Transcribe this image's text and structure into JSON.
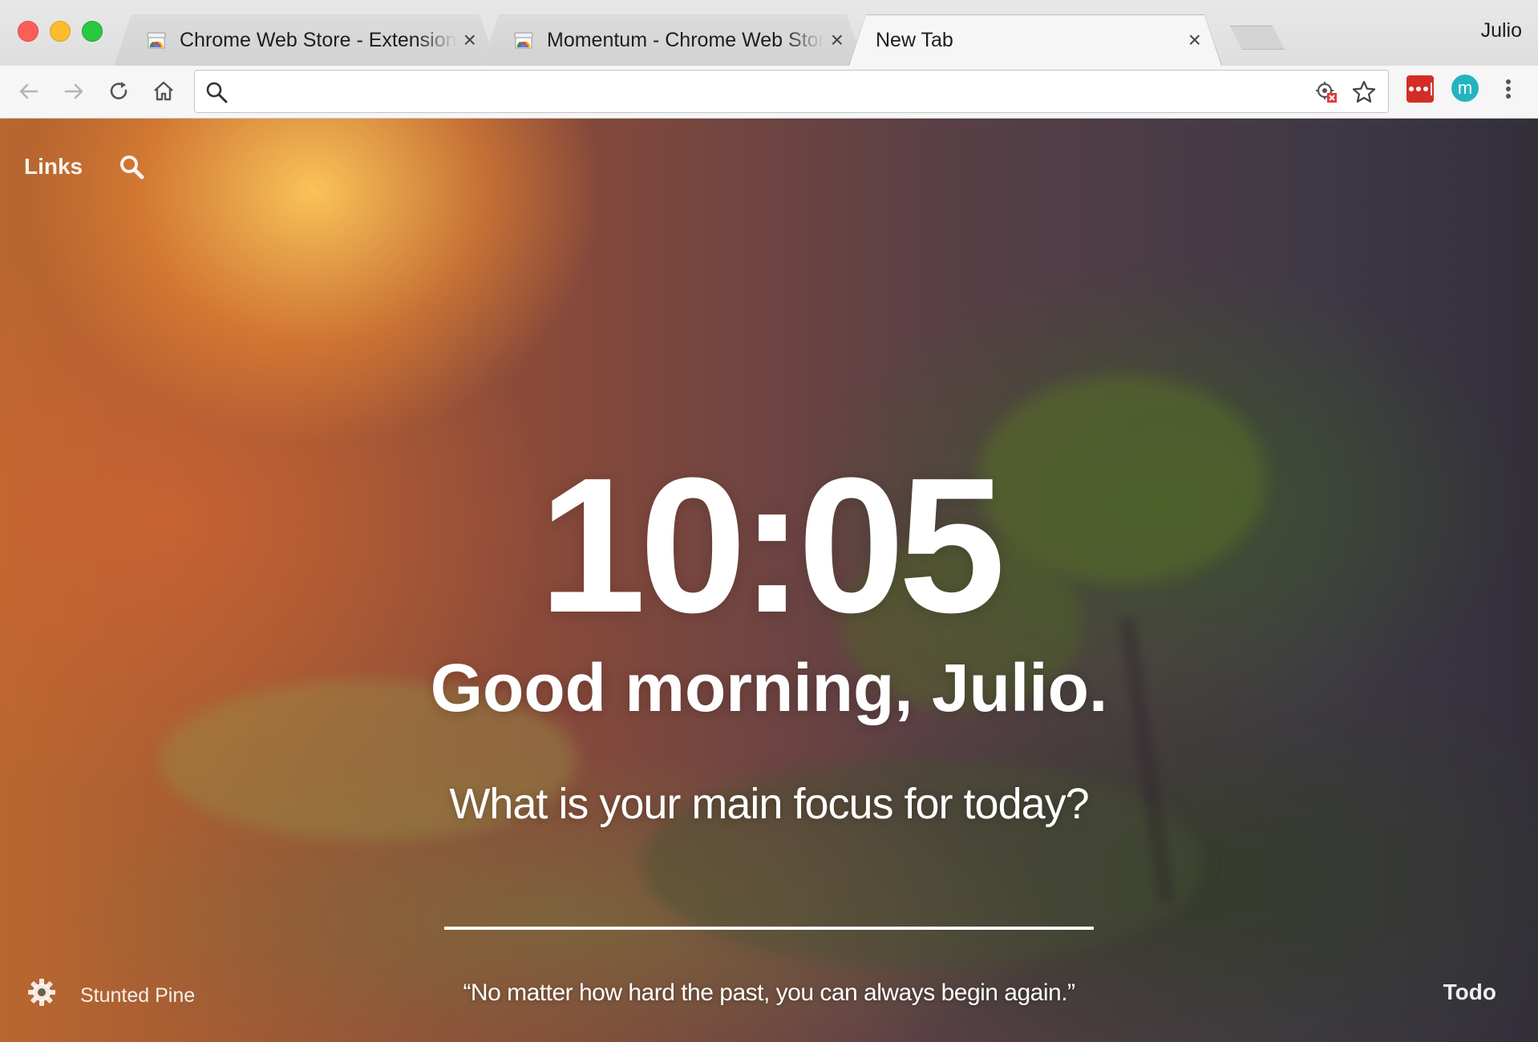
{
  "browser": {
    "tabs": [
      {
        "label": "Chrome Web Store - Extensions",
        "favicon": "chrome-web-store-icon",
        "active": false
      },
      {
        "label": "Momentum - Chrome Web Store",
        "favicon": "chrome-web-store-icon",
        "active": false
      },
      {
        "label": "New Tab",
        "favicon": "",
        "active": true
      }
    ],
    "close_glyph": "×",
    "profile_name": "Julio",
    "omnibox": {
      "value": "",
      "placeholder": ""
    },
    "extensions": [
      {
        "name": "lastpass-icon",
        "color": "#d32d27"
      },
      {
        "name": "momentum-icon",
        "glyph": "m",
        "color": "#23b5bf"
      }
    ]
  },
  "momentum": {
    "links_label": "Links",
    "time": "10:05",
    "greeting": "Good morning, Julio.",
    "focus_question": "What is your main focus for today?",
    "focus_value": "",
    "photo_credit": "Stunted Pine",
    "quote": "“No matter how hard the past, you can always begin again.”",
    "todo_label": "Todo"
  }
}
